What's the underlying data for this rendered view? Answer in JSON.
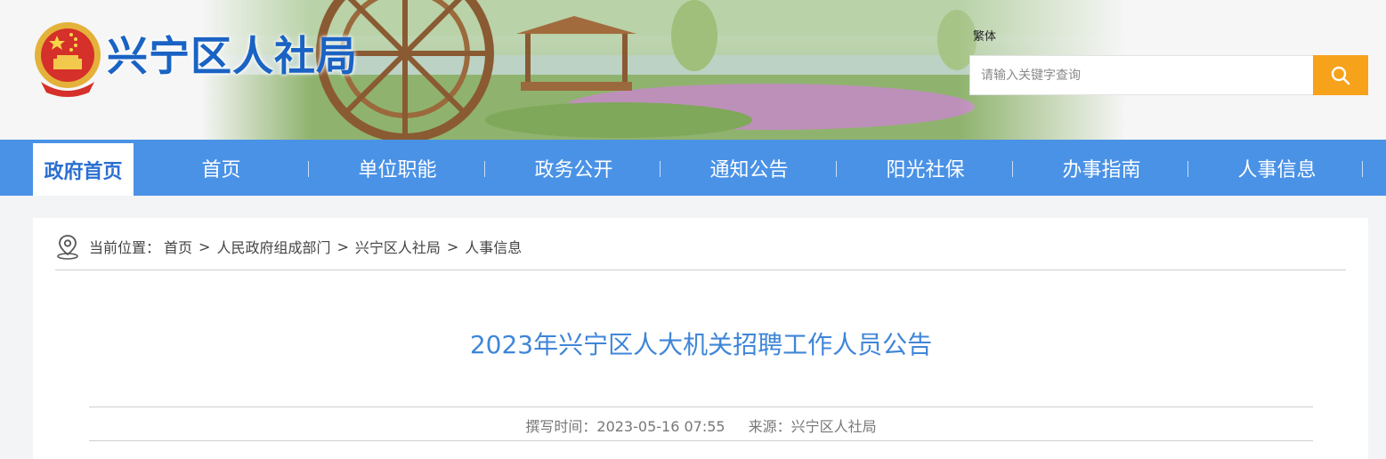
{
  "header": {
    "site_title": "兴宁区人社局",
    "traditional_link": "繁体",
    "search": {
      "placeholder": "请输入关键字查询"
    }
  },
  "nav": {
    "home_badge": "政府首页",
    "items": [
      {
        "label": "首页"
      },
      {
        "label": "单位职能"
      },
      {
        "label": "政务公开"
      },
      {
        "label": "通知公告"
      },
      {
        "label": "阳光社保"
      },
      {
        "label": "办事指南"
      },
      {
        "label": "人事信息"
      }
    ]
  },
  "breadcrumb": {
    "prefix": "当前位置：",
    "items": [
      "首页",
      "人民政府组成部门",
      "兴宁区人社局",
      "人事信息"
    ],
    "separator": ">"
  },
  "article": {
    "title": "2023年兴宁区人大机关招聘工作人员公告",
    "time_label": "撰写时间：",
    "time_value": "2023-05-16 07:55",
    "source_label": "来源：",
    "source_value": "兴宁区人社局"
  },
  "colors": {
    "nav_bg": "#4a92e6",
    "title_blue": "#1a63c4",
    "article_title": "#3f86d8",
    "search_button": "#f7a21b"
  }
}
